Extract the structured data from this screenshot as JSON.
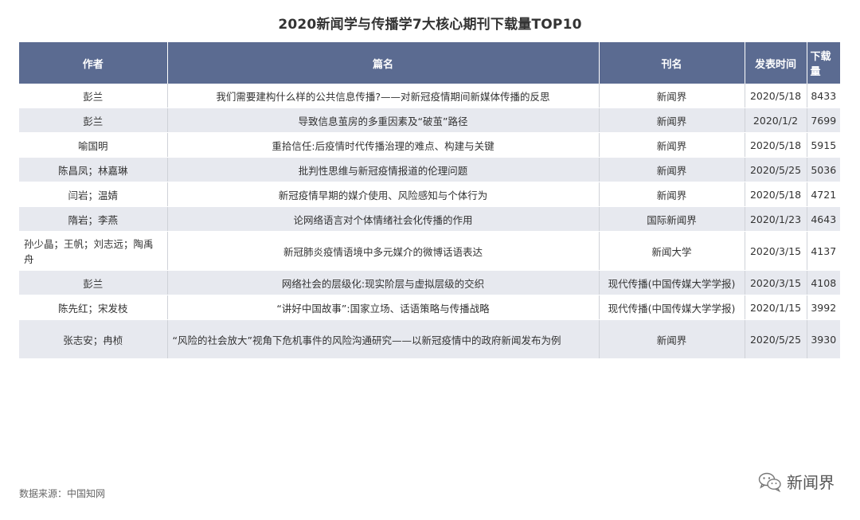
{
  "title": "2020新闻学与传播学7大核心期刊下载量TOP10",
  "table": {
    "headers": [
      "作者",
      "篇名",
      "刊名",
      "发表时间",
      "下载量"
    ],
    "rows": [
      {
        "author": "彭兰",
        "title": "我们需要建构什么样的公共信息传播?——对新冠疫情期间新媒体传播的反思",
        "journal": "新闻界",
        "date": "2020/5/18",
        "downloads": "8433"
      },
      {
        "author": "彭兰",
        "title": "导致信息茧房的多重因素及“破茧”路径",
        "journal": "新闻界",
        "date": "2020/1/2",
        "downloads": "7699"
      },
      {
        "author": "喻国明",
        "title": "重拾信任:后疫情时代传播治理的难点、构建与关键",
        "journal": "新闻界",
        "date": "2020/5/18",
        "downloads": "5915"
      },
      {
        "author": "陈昌凤；林嘉琳",
        "title": "批判性思维与新冠疫情报道的伦理问题",
        "journal": "新闻界",
        "date": "2020/5/25",
        "downloads": "5036"
      },
      {
        "author": "闫岩；温婧",
        "title": "新冠疫情早期的媒介使用、风险感知与个体行为",
        "journal": "新闻界",
        "date": "2020/5/18",
        "downloads": "4721"
      },
      {
        "author": "隋岩；李燕",
        "title": "论网络语言对个体情绪社会化传播的作用",
        "journal": "国际新闻界",
        "date": "2020/1/23",
        "downloads": "4643"
      },
      {
        "author": "孙少晶；王帆；刘志远；陶禹舟",
        "title": "新冠肺炎疫情语境中多元媒介的微博话语表达",
        "journal": "新闻大学",
        "date": "2020/3/15",
        "downloads": "4137"
      },
      {
        "author": "彭兰",
        "title": "网络社会的层级化:现实阶层与虚拟层级的交织",
        "journal": "现代传播(中国传媒大学学报)",
        "date": "2020/3/15",
        "downloads": "4108"
      },
      {
        "author": "陈先红；宋发枝",
        "title": "“讲好中国故事”:国家立场、话语策略与传播战略",
        "journal": "现代传播(中国传媒大学学报)",
        "date": "2020/1/15",
        "downloads": "3992"
      },
      {
        "author": "张志安；冉桢",
        "title": "“风险的社会放大”视角下危机事件的风险沟通研究——以新冠疫情中的政府新闻发布为例",
        "journal": "新闻界",
        "date": "2020/5/25",
        "downloads": "3930"
      }
    ]
  },
  "source": "数据来源：中国知网",
  "brand": {
    "name": "新闻界",
    "icon": "wechat-icon"
  },
  "colors": {
    "header_bg": "#5b6b91",
    "stripe": "#e7e9ef"
  }
}
